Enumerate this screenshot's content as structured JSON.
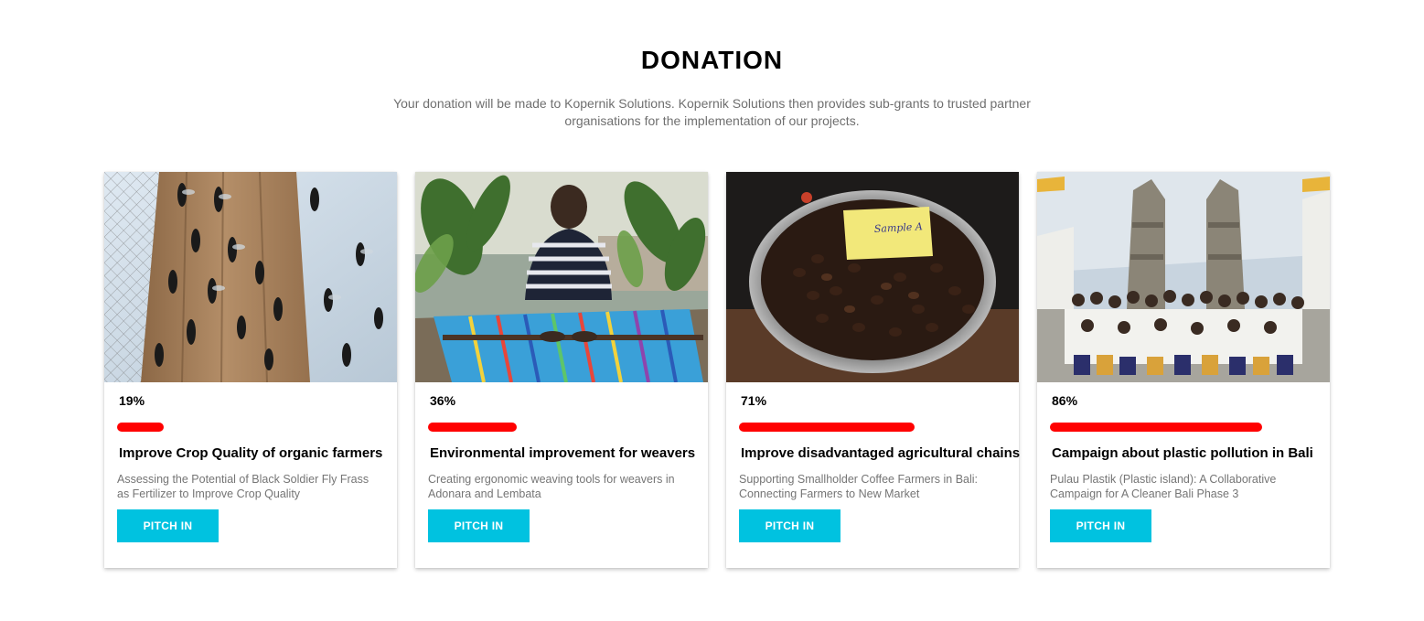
{
  "header": {
    "title": "DONATION",
    "intro": "Your donation will be made to Kopernik Solutions. Kopernik Solutions then provides sub-grants to trusted partner organisations for the implementation of our projects."
  },
  "colors": {
    "progress": "#ff0000",
    "button": "#00c2e0"
  },
  "cards": [
    {
      "percent_label": "19%",
      "progress": 0.19,
      "title": "Improve Crop Quality of organic farmers",
      "description": "Assessing the Potential of Black Soldier Fly Frass as Fertilizer to Improve Crop Quality",
      "button_label": "PITCH IN",
      "image_subject": "black-soldier-flies-on-wooden-post"
    },
    {
      "percent_label": "36%",
      "progress": 0.36,
      "title": "Environmental improvement for weavers",
      "description": "Creating ergonomic weaving tools for weavers in Adonara and Lembata",
      "button_label": "PITCH IN",
      "image_subject": "woman-weaving-striped-cloth"
    },
    {
      "percent_label": "71%",
      "progress": 0.71,
      "title": "Improve disadvantaged agricultural chains",
      "description": "Supporting Smallholder Coffee Farmers in Bali: Connecting Farmers to New Market",
      "button_label": "PITCH IN",
      "image_subject": "coffee-beans-in-sieve",
      "image_note": "Sample A"
    },
    {
      "percent_label": "86%",
      "progress": 0.86,
      "title": "Campaign about plastic pollution in Bali",
      "description": "Pulau Plastik (Plastic island): A Collaborative Campaign for A Cleaner Bali Phase 3",
      "button_label": "PITCH IN",
      "image_subject": "group-at-balinese-temple-gate"
    }
  ]
}
